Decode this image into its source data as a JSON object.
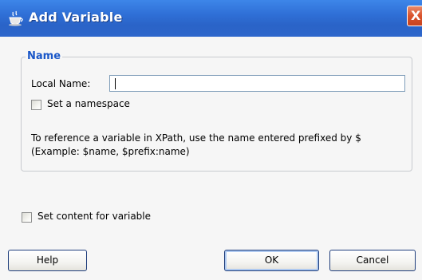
{
  "window": {
    "title": "Add Variable",
    "close_glyph": "X",
    "title_icon": "jdeveloper-cup-icon"
  },
  "name_group": {
    "legend": "Name",
    "local_name_label": "Local Name:",
    "local_name_value": "",
    "namespace_checkbox_label": "Set a namespace",
    "namespace_checked": false,
    "hint_line1": "To reference a variable in XPath, use the name entered prefixed by $",
    "hint_line2": "(Example: $name, $prefix:name)"
  },
  "content_checkbox": {
    "label": "Set content for variable",
    "checked": false
  },
  "buttons": {
    "help": "Help",
    "ok": "OK",
    "cancel": "Cancel"
  },
  "colors": {
    "title_bar": "#2f6fd6",
    "legend": "#1a57c8",
    "close_button": "#d9532c"
  }
}
